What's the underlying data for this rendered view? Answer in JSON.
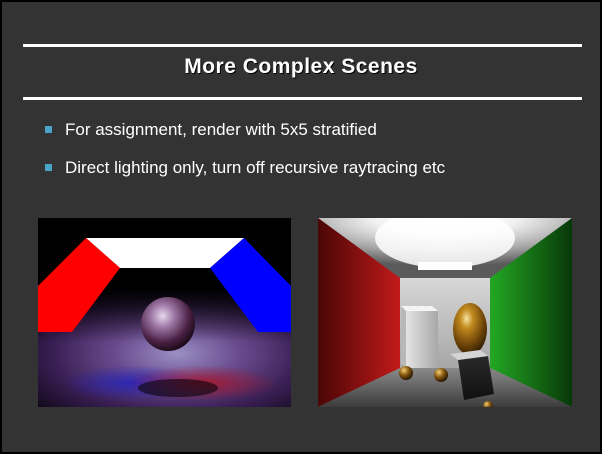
{
  "slide": {
    "title": "More Complex Scenes",
    "bullets": [
      {
        "text": "For assignment, render with 5x5 stratified"
      },
      {
        "text": "Direct lighting only, turn off recursive raytracing etc"
      }
    ]
  },
  "images": [
    {
      "name": "sphere-scene-render"
    },
    {
      "name": "cornell-box-render"
    }
  ],
  "colors": {
    "background": "#333333",
    "title_text": "#ffffff",
    "bullet_text": "#ffffff",
    "bullet_marker": "#4aa3c8",
    "rule": "#ffffff"
  }
}
